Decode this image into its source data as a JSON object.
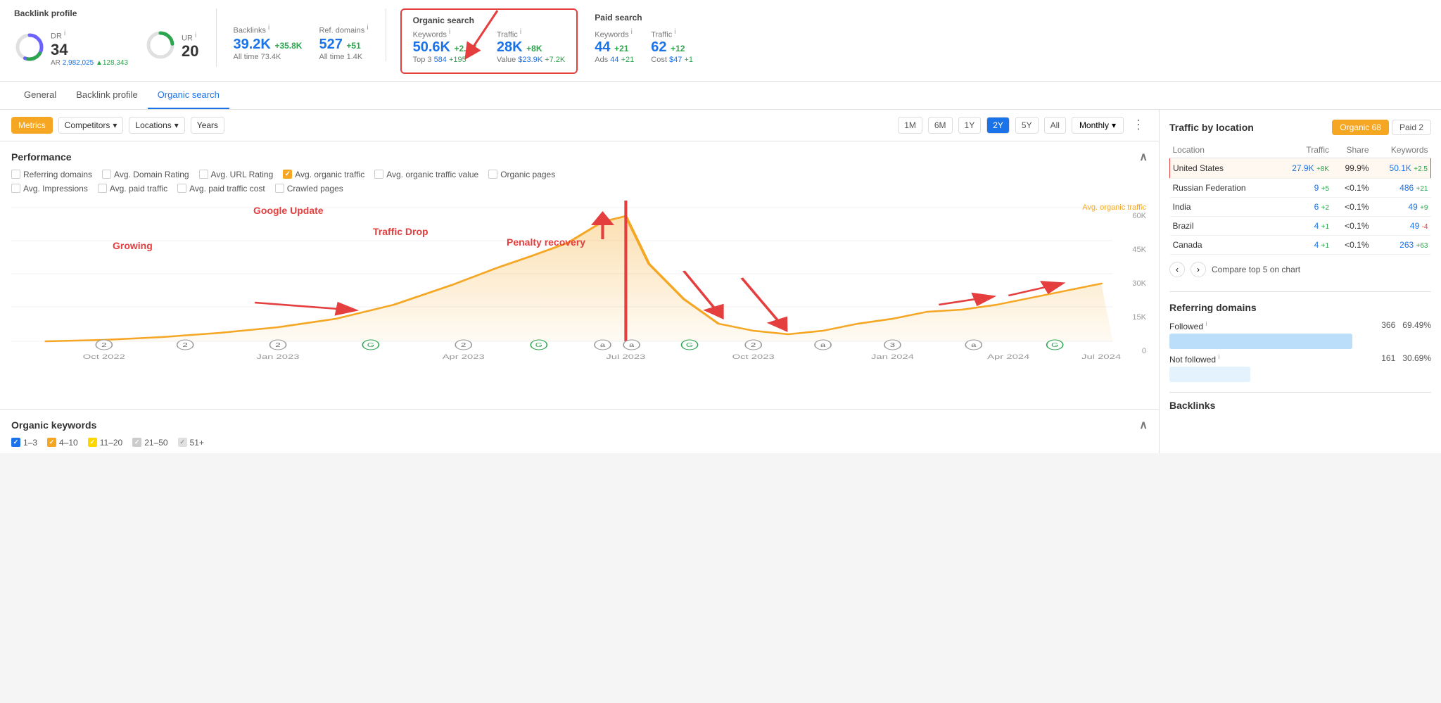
{
  "header": {
    "backlink_profile_label": "Backlink profile",
    "dr_label": "DR",
    "dr_value": "34",
    "ar_label": "AR",
    "ar_value": "2,982,025",
    "ar_delta": "▲128,343",
    "ur_label": "UR",
    "ur_value": "20",
    "backlinks_label": "Backlinks",
    "backlinks_value": "39.2K",
    "backlinks_delta": "+35.8K",
    "backlinks_alltime": "All time  73.4K",
    "ref_domains_label": "Ref. domains",
    "ref_domains_value": "527",
    "ref_domains_delta": "+51",
    "ref_domains_alltime": "All time  1.4K",
    "organic_section_label": "Organic search",
    "organic_kw_label": "Keywords",
    "organic_kw_value": "50.6K",
    "organic_kw_delta": "+2.6K",
    "organic_top3_label": "Top 3",
    "organic_top3_value": "584",
    "organic_top3_delta": "+195",
    "organic_traffic_label": "Traffic",
    "organic_traffic_value": "28K",
    "organic_traffic_delta": "+8K",
    "organic_value_label": "Value",
    "organic_value_value": "$23.9K",
    "organic_value_delta": "+7.2K",
    "paid_section_label": "Paid search",
    "paid_kw_label": "Keywords",
    "paid_kw_value": "44",
    "paid_kw_delta": "+21",
    "paid_ads_label": "Ads",
    "paid_ads_value": "44",
    "paid_ads_delta": "+21",
    "paid_traffic_label": "Traffic",
    "paid_traffic_value": "62",
    "paid_traffic_delta": "+12",
    "paid_cost_label": "Cost",
    "paid_cost_value": "$47",
    "paid_cost_delta": "+1"
  },
  "nav": {
    "tabs": [
      "General",
      "Backlink profile",
      "Organic search"
    ],
    "active": "General"
  },
  "toolbar": {
    "metrics_label": "Metrics",
    "competitors_label": "Competitors",
    "locations_label": "Locations",
    "years_label": "Years",
    "time_buttons": [
      "1M",
      "6M",
      "1Y",
      "2Y",
      "5Y",
      "All"
    ],
    "active_time": "2Y",
    "monthly_label": "Monthly"
  },
  "performance": {
    "title": "Performance",
    "checkboxes_row1": [
      {
        "label": "Referring domains",
        "checked": false
      },
      {
        "label": "Avg. Domain Rating",
        "checked": false
      },
      {
        "label": "Avg. URL Rating",
        "checked": false
      },
      {
        "label": "Avg. organic traffic",
        "checked": true,
        "orange": true
      },
      {
        "label": "Avg. organic traffic value",
        "checked": false
      },
      {
        "label": "Organic pages",
        "checked": false
      }
    ],
    "checkboxes_row2": [
      {
        "label": "Avg. Impressions",
        "checked": false
      },
      {
        "label": "Avg. paid traffic",
        "checked": false
      },
      {
        "label": "Avg. paid traffic cost",
        "checked": false
      },
      {
        "label": "Crawled pages",
        "checked": false
      }
    ],
    "chart_label": "Avg. organic traffic",
    "y_labels": [
      "60K",
      "45K",
      "30K",
      "15K",
      "0"
    ],
    "x_labels": [
      "Oct 2022",
      "Jan 2023",
      "Apr 2023",
      "Jul 2023",
      "Oct 2023",
      "Jan 2024",
      "Apr 2024",
      "Jul 2024"
    ],
    "annotations": {
      "growing": "Growing",
      "google_update": "Google Update",
      "traffic_drop": "Traffic Drop",
      "penalty_recovery": "Penalty recovery"
    }
  },
  "organic_keywords": {
    "title": "Organic keywords",
    "filters": [
      {
        "label": "1–3",
        "checked": true,
        "color": "#1a73e8"
      },
      {
        "label": "4–10",
        "checked": true,
        "color": "#f5a623"
      },
      {
        "label": "11–20",
        "checked": true,
        "color": "#ffd700"
      },
      {
        "label": "21–50",
        "checked": true,
        "color": "#ccc"
      },
      {
        "label": "51+",
        "checked": true,
        "color": "#eee"
      }
    ]
  },
  "right_panel": {
    "traffic_by_location_title": "Traffic by location",
    "organic_btn": "Organic 68",
    "paid_btn": "Paid 2",
    "table_headers": [
      "Location",
      "Traffic",
      "Share",
      "Keywords"
    ],
    "locations": [
      {
        "name": "United States",
        "traffic": "27.9K",
        "traffic_delta": "+8K",
        "share": "99.9%",
        "keywords": "50.1K",
        "keywords_delta": "+2.5",
        "highlight": true
      },
      {
        "name": "Russian Federation",
        "traffic": "9",
        "traffic_delta": "+5",
        "share": "<0.1%",
        "keywords": "486",
        "keywords_delta": "+21"
      },
      {
        "name": "India",
        "traffic": "6",
        "traffic_delta": "+2",
        "share": "<0.1%",
        "keywords": "49",
        "keywords_delta": "+9"
      },
      {
        "name": "Brazil",
        "traffic": "4",
        "traffic_delta": "+1",
        "share": "<0.1%",
        "keywords": "49",
        "keywords_delta": "-4"
      },
      {
        "name": "Canada",
        "traffic": "4",
        "traffic_delta": "+1",
        "share": "<0.1%",
        "keywords": "263",
        "keywords_delta": "+63"
      }
    ],
    "compare_label": "Compare top 5 on chart",
    "referring_domains_title": "Referring domains",
    "followed_label": "Followed",
    "followed_value": "366",
    "followed_pct": "69.49%",
    "not_followed_label": "Not followed",
    "not_followed_value": "161",
    "not_followed_pct": "30.69%",
    "backlinks_title": "Backlinks"
  }
}
